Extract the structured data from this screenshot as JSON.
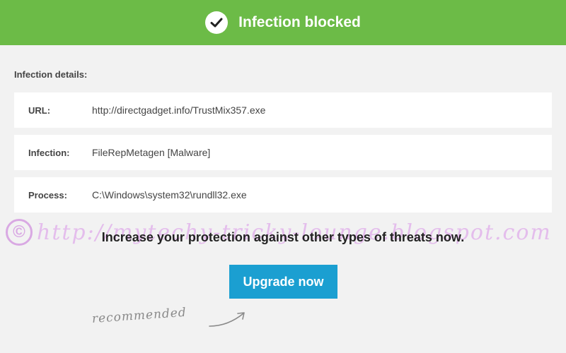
{
  "header": {
    "title": "Infection blocked",
    "icon": "checkmark-icon",
    "color": "#6cbb47"
  },
  "details": {
    "section_label": "Infection details:",
    "rows": [
      {
        "key": "URL:",
        "value": "http://directgadget.info/TrustMix357.exe"
      },
      {
        "key": "Infection:",
        "value": "FileRepMetagen [Malware]"
      },
      {
        "key": "Process:",
        "value": "C:\\Windows\\system32\\rundll32.exe"
      }
    ]
  },
  "promo": {
    "text": "Increase your protection against other types of threats now.",
    "button_label": "Upgrade now",
    "button_color": "#1b9fd1",
    "note": "recommended"
  },
  "watermark": {
    "symbol": "©",
    "text": "http://mytechy-tricky-lounge.blogspot.com"
  }
}
